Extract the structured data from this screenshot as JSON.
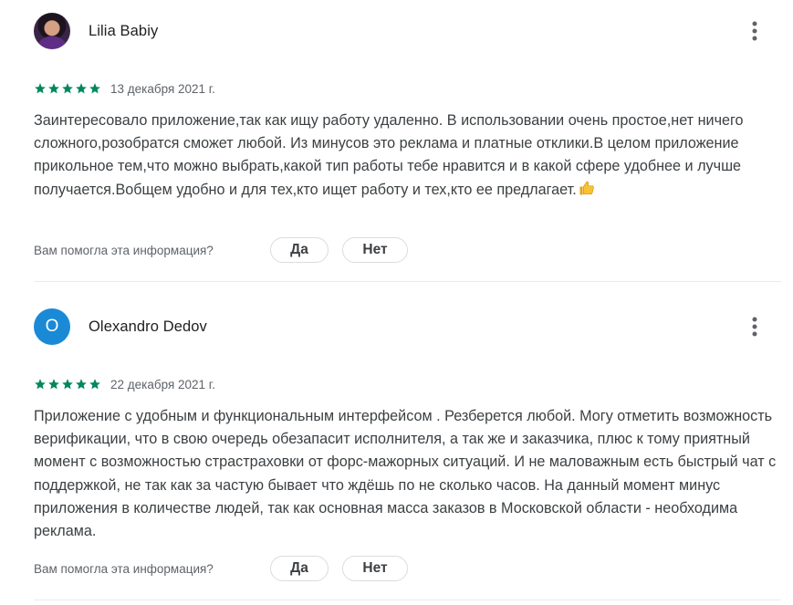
{
  "reviews": [
    {
      "author": "Lilia Babiy",
      "avatar_type": "photo",
      "avatar_letter": "",
      "rating": 5,
      "date": "13 декабря 2021 г.",
      "text": "Заинтересовало приложение,так как ищу работу удаленно. В использовании очень простое,нет ничего сложного,розобратся сможет любой. Из минусов это реклама и платные отклики.В целом приложение прикольное тем,что можно выбрать,какой тип работы тебе нравится и в какой сфере удобнее и лучше получается.Вобщем удобно и для тех,кто ищет работу и тех,кто ее предлагает.",
      "text_emoji": "thumbs-up-icon"
    },
    {
      "author": "Olexandro Dedov",
      "avatar_type": "letter",
      "avatar_letter": "O",
      "rating": 5,
      "date": "22 декабря 2021 г.",
      "text": "Приложение с удобным и функциональным интерфейсом . Резберется любой. Могу отметить возможность верификации, что в свою очередь обезапасит исполнителя, а так же и заказчика, плюс к тому приятный момент с возможностью страстраховки от форс-мажорных ситуаций. И не маловажным есть быстрый чат с поддержкой, не так как за частую бывает что ждёшь по не сколько часов. На данный момент минус приложения в количестве людей, так как основная масса заказов в Московской области - необходима реклама."
    }
  ],
  "helpful": {
    "question": "Вам помогла эта информация?",
    "yes_label": "Да",
    "no_label": "Нет"
  },
  "colors": {
    "star": "#01875f",
    "avatar_letter_bg": "#1a8ad6",
    "text": "#3c4043",
    "secondary": "#5f6368",
    "divider": "#e8eaed"
  },
  "icons": {
    "menu": "more-vert-icon",
    "star": "star-icon"
  }
}
